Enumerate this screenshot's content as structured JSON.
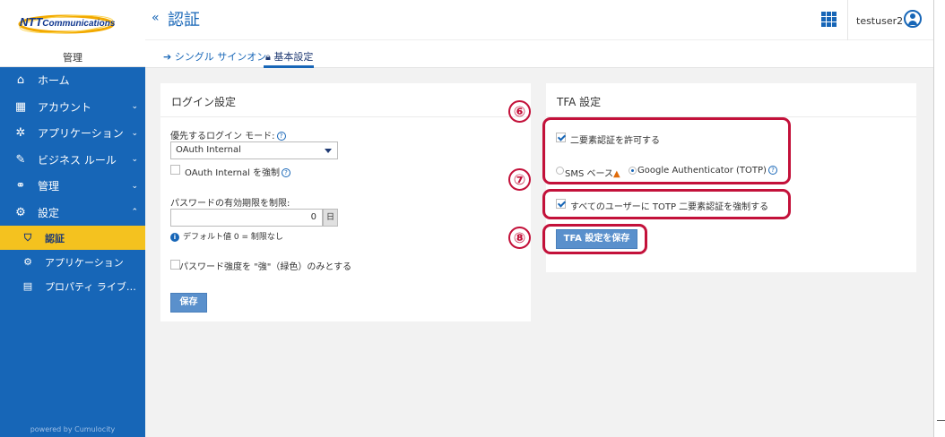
{
  "sidebar": {
    "logo_text": "NTT",
    "logo_sub": "Communications",
    "mgmt_label": "管理",
    "items": [
      {
        "label": "ホーム",
        "icon": "home-icon"
      },
      {
        "label": "アカウント",
        "icon": "account-icon"
      },
      {
        "label": "アプリケーション",
        "icon": "applications-icon"
      },
      {
        "label": "ビジネス ルール",
        "icon": "business-rule-icon"
      },
      {
        "label": "管理",
        "icon": "handshake-icon"
      },
      {
        "label": "設定",
        "icon": "gear-icon"
      }
    ],
    "sub_items": [
      {
        "label": "認証",
        "icon": "shield-icon"
      },
      {
        "label": "アプリケーション",
        "icon": "gear-icon"
      },
      {
        "label": "プロパティ ライブ…",
        "icon": "book-icon"
      }
    ],
    "powered_by": "powered by Cumulocity"
  },
  "header": {
    "collapse": "«",
    "title": "認証",
    "username": "testuser2"
  },
  "tabs": [
    {
      "label": "シングル サインオン",
      "icon": "sign-in-icon"
    },
    {
      "label": "基本設定",
      "icon": "lock-icon"
    }
  ],
  "login_settings": {
    "title": "ログイン設定",
    "mode_label": "優先するログイン モード:",
    "mode_value": "OAuth Internal",
    "enforce_label": "OAuth Internal を強制",
    "pw_expiry_label": "パスワードの有効期限を制限:",
    "pw_expiry_value": "0",
    "cal": "日",
    "default_note": "デフォルト値 0 = 制限なし",
    "strength_label": "パスワード強度を \"強\"（緑色）のみとする",
    "save": "保存"
  },
  "tfa_settings": {
    "title": "TFA 設定",
    "allow_label": "二要素認証を許可する",
    "sms_label": "SMS ベース",
    "google_label": "Google Authenticator (TOTP)",
    "force_label": "すべてのユーザーに TOTP 二要素認証を強制する",
    "save": "TFA 設定を保存"
  },
  "annotations": {
    "six": "⑥",
    "seven": "⑦",
    "eight": "⑧"
  },
  "colors": {
    "sidebar": "#1766b7",
    "active": "#f4c21f",
    "highlight": "#c3113a",
    "button": "#5a90cc"
  }
}
